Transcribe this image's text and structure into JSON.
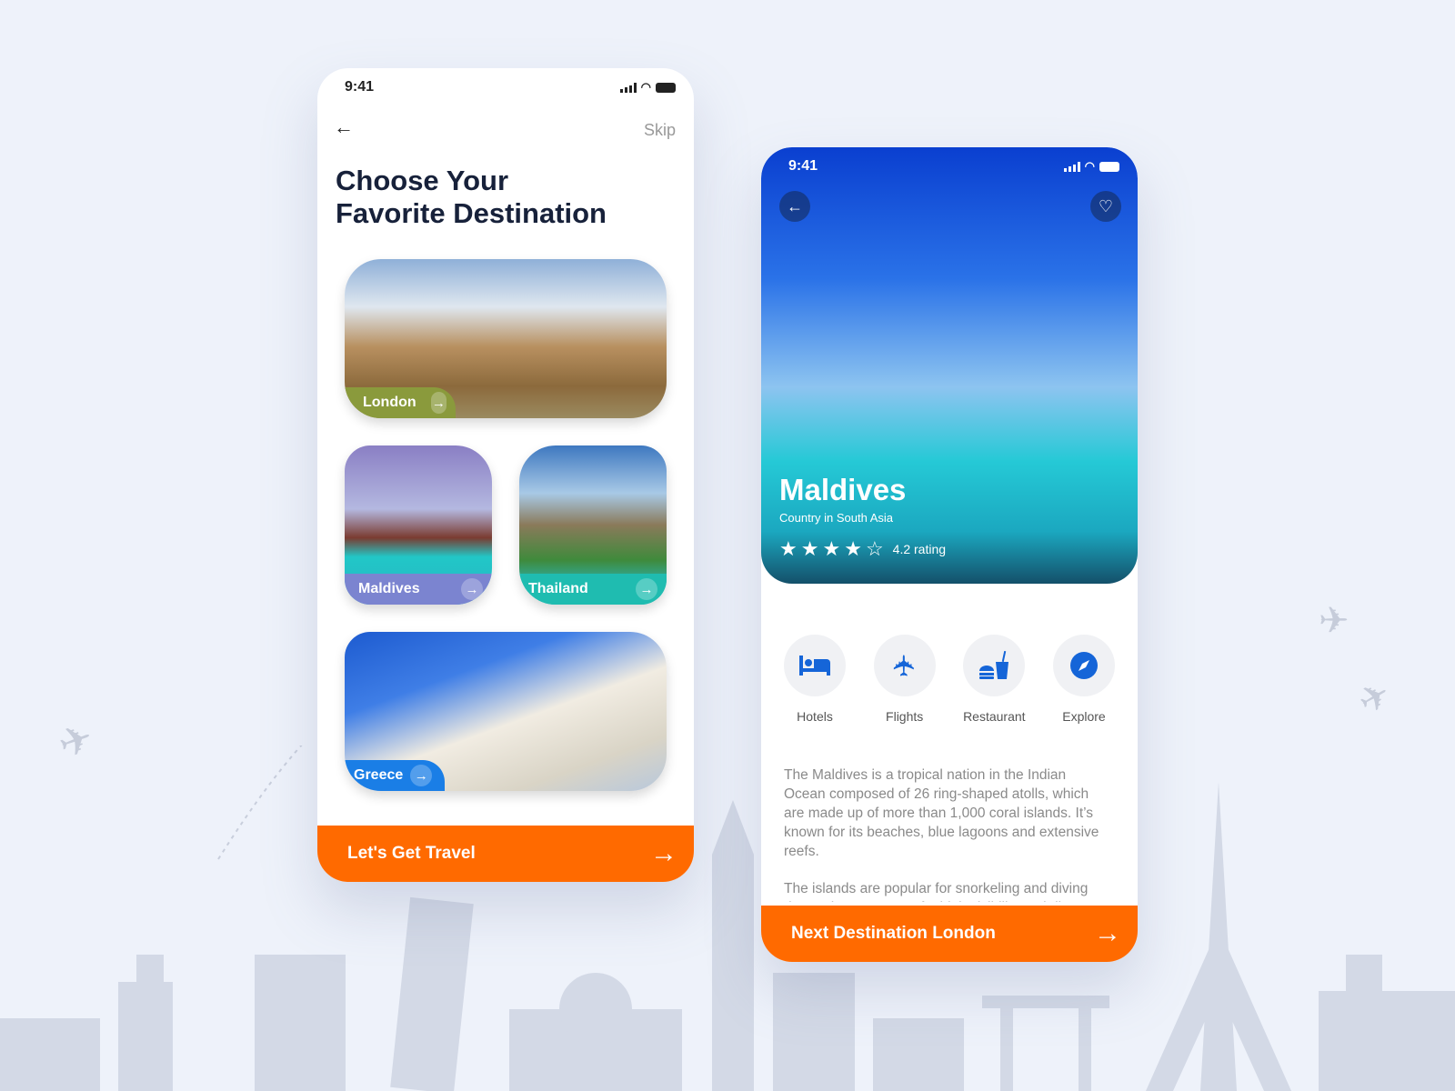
{
  "left_screen": {
    "status_time": "9:41",
    "back_icon": "←",
    "skip_label": "Skip",
    "title_line1": "Choose Your",
    "title_line2": "Favorite Destination",
    "destinations": [
      {
        "name": "London",
        "color": "#8a9a3c"
      },
      {
        "name": "Maldives",
        "color": "#7b84d0"
      },
      {
        "name": "Thailand",
        "color": "#1fbcb0"
      },
      {
        "name": "Greece",
        "color": "#1a7ee6"
      }
    ],
    "arrow": "→",
    "cta_label": "Let's Get Travel",
    "cta_arrow": "→"
  },
  "right_screen": {
    "status_time": "9:41",
    "back_icon": "←",
    "heart_icon": "♡",
    "place_name": "Maldives",
    "place_subtitle": "Country in South Asia",
    "rating": 4.2,
    "rating_label": "4.2 rating",
    "stars": [
      "★",
      "★",
      "★",
      "★",
      "☆"
    ],
    "categories": [
      {
        "label": "Hotels",
        "icon": "bed-icon"
      },
      {
        "label": "Flights",
        "icon": "airplane-icon"
      },
      {
        "label": "Restaurant",
        "icon": "food-drink-icon"
      },
      {
        "label": "Explore",
        "icon": "compass-icon"
      }
    ],
    "description": [
      "The Maldives is a tropical nation in the Indian Ocean composed of 26 ring-shaped atolls, which are made up of more than 1,000 coral islands. It’s known for its beaches, blue lagoons and extensive reefs.",
      "The islands are popular for snorkeling and diving due to the presence of a high visibility and diverse"
    ],
    "cta_label": "Next Destination London",
    "cta_arrow": "→"
  },
  "colors": {
    "accent": "#ff6a00",
    "primary_blue": "#1565d8",
    "title": "#17213a"
  }
}
